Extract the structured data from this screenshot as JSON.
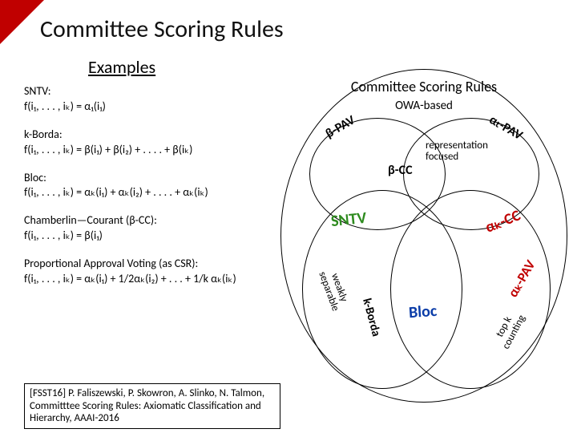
{
  "title": "Committee Scoring Rules",
  "examples_heading": "Examples",
  "rules": {
    "sntv": {
      "name": "SNTV:",
      "formula": "f(i₁, . . . , iₖ) = α₁(i₁)"
    },
    "kborda": {
      "name": "k-Borda:",
      "formula": "f(i₁, . . . , iₖ) = β(i₁) + β(i₂) + . . . . + β(iₖ)"
    },
    "bloc": {
      "name": "Bloc:",
      "formula": "f(i₁, . . . , iₖ) = αₖ(i₁) + αₖ(i₂) + . . . . + αₖ(iₖ)"
    },
    "cc": {
      "name": "Chamberlin—Courant (β-CC):",
      "formula": "f(i₁, . . . , iₖ) = β(i₁)"
    },
    "pav": {
      "name": "Proportional Approval Voting (as CSR):",
      "formula": "f(i₁, . . . , iₖ) = αₖ(i₁) + 1/2αₖ(i₂) + . . . + 1/k αₖ(iₖ)"
    }
  },
  "reference": "[FSST16] P. Faliszewski, P. Skowron, A. Slinko, N. Talmon, Committtee Scoring Rules: Axiomatic Classification and Hierarchy, AAAI-2016",
  "diagram": {
    "title": "Committee Scoring Rules",
    "owa": "OWA-based",
    "beta_pav": "β-PAV",
    "alpha_t_pav": "αₜ-PAV",
    "rep": "representation focused",
    "beta_cc": "β-CC",
    "sntv": "SNTV",
    "alpha_k_cc": "αₖ-CC",
    "weakly": "weakly separable",
    "kborda": "k-Borda",
    "bloc": "Bloc",
    "alpha_k_pav": "αₖ-PAV",
    "topk": "top k counting"
  }
}
